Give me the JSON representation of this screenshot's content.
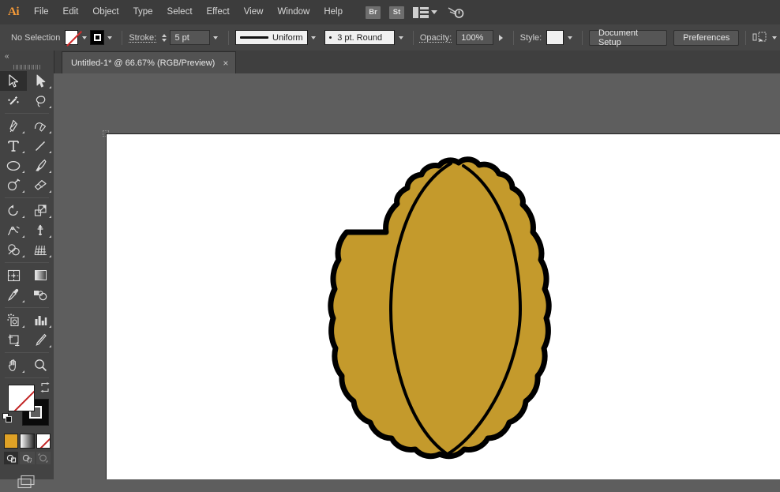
{
  "app": {
    "logo": "Ai",
    "name": "Adobe Illustrator"
  },
  "menubar": {
    "items": [
      {
        "label": "File"
      },
      {
        "label": "Edit"
      },
      {
        "label": "Object"
      },
      {
        "label": "Type"
      },
      {
        "label": "Select"
      },
      {
        "label": "Effect"
      },
      {
        "label": "View"
      },
      {
        "label": "Window"
      },
      {
        "label": "Help"
      }
    ],
    "bridge_label": "Br",
    "stock_label": "St",
    "arrange_icon": "arrange-documents-icon",
    "arrange_chevron": "chevron-down-icon",
    "search_icon": "search-adobe-stock-icon"
  },
  "controlbar": {
    "selection_status": "No Selection",
    "fill_swatch": "none-swatch",
    "fill_chevron": "chevron-down-icon",
    "stroke_swatch": "black-swatch",
    "stroke_chevron": "chevron-down-icon",
    "stroke_label": "Stroke:",
    "stroke_weight": "5 pt",
    "stroke_weight_chevron": "chevron-down-icon",
    "stroke_profile": "Uniform",
    "stroke_profile_chevron": "chevron-down-icon",
    "brush_definition": "3 pt. Round",
    "brush_chevron": "chevron-down-icon",
    "opacity_label": "Opacity:",
    "opacity_value": "100%",
    "opacity_arrow": "arrow-right-icon",
    "style_label": "Style:",
    "style_swatch": "white-graphic-style-swatch",
    "style_chevron": "chevron-down-icon",
    "document_setup_label": "Document Setup",
    "preferences_label": "Preferences",
    "align_icon": "align-to-artboard-icon",
    "align_chevron": "chevron-down-icon"
  },
  "tabbar": {
    "tab_title": "Untitled-1* @ 66.67% (RGB/Preview)",
    "close_label": "×"
  },
  "toolbar": {
    "collapse_label": "«",
    "tools": [
      {
        "name": "selection-tool",
        "active": true
      },
      {
        "name": "direct-selection-tool",
        "active": false
      },
      {
        "name": "magic-wand-tool",
        "active": false
      },
      {
        "name": "lasso-tool",
        "active": false
      },
      {
        "name": "pen-tool",
        "active": false
      },
      {
        "name": "curvature-tool",
        "active": false
      },
      {
        "name": "type-tool",
        "active": false
      },
      {
        "name": "line-segment-tool",
        "active": false
      },
      {
        "name": "ellipse-tool",
        "active": false
      },
      {
        "name": "paintbrush-tool",
        "active": false
      },
      {
        "name": "shaper-tool",
        "active": false
      },
      {
        "name": "eraser-tool",
        "active": false
      },
      {
        "name": "rotate-tool",
        "active": false
      },
      {
        "name": "scale-tool",
        "active": false
      },
      {
        "name": "width-tool",
        "active": false
      },
      {
        "name": "free-transform-tool",
        "active": false
      },
      {
        "name": "shape-builder-tool",
        "active": false
      },
      {
        "name": "perspective-grid-tool",
        "active": false
      },
      {
        "name": "mesh-tool",
        "active": false
      },
      {
        "name": "gradient-tool",
        "active": false
      },
      {
        "name": "eyedropper-tool",
        "active": false
      },
      {
        "name": "blend-tool",
        "active": false
      },
      {
        "name": "symbol-sprayer-tool",
        "active": false
      },
      {
        "name": "column-graph-tool",
        "active": false
      },
      {
        "name": "artboard-tool",
        "active": false
      },
      {
        "name": "slice-tool",
        "active": false
      },
      {
        "name": "hand-tool",
        "active": false
      },
      {
        "name": "zoom-tool",
        "active": false
      }
    ],
    "fill_stroke": {
      "fill": "None",
      "stroke": "Black",
      "swap_icon": "swap-fill-stroke-icon",
      "default_icon": "default-fill-stroke-icon"
    },
    "color_swatches": [
      {
        "name": "color-swatch",
        "value": "#e0a226"
      },
      {
        "name": "gradient-swatch",
        "value": "#ffffff"
      },
      {
        "name": "none-swatch",
        "value": "#ffffff"
      }
    ],
    "draw_modes": [
      {
        "name": "draw-normal-mode",
        "active": true
      },
      {
        "name": "draw-behind-mode",
        "active": false
      },
      {
        "name": "draw-inside-mode",
        "active": false
      }
    ],
    "screen_mode": "change-screen-mode-icon"
  },
  "canvas": {
    "background_color": "#5e5e5e",
    "artboard_color": "#ffffff",
    "zoom_level": "66.67%",
    "artwork": {
      "name": "walnut-illustration",
      "fill_color": "#c49a2c",
      "stroke_color": "#000000",
      "description": "Gold walnut shape with scalloped outline and two curved dividing lines"
    }
  }
}
